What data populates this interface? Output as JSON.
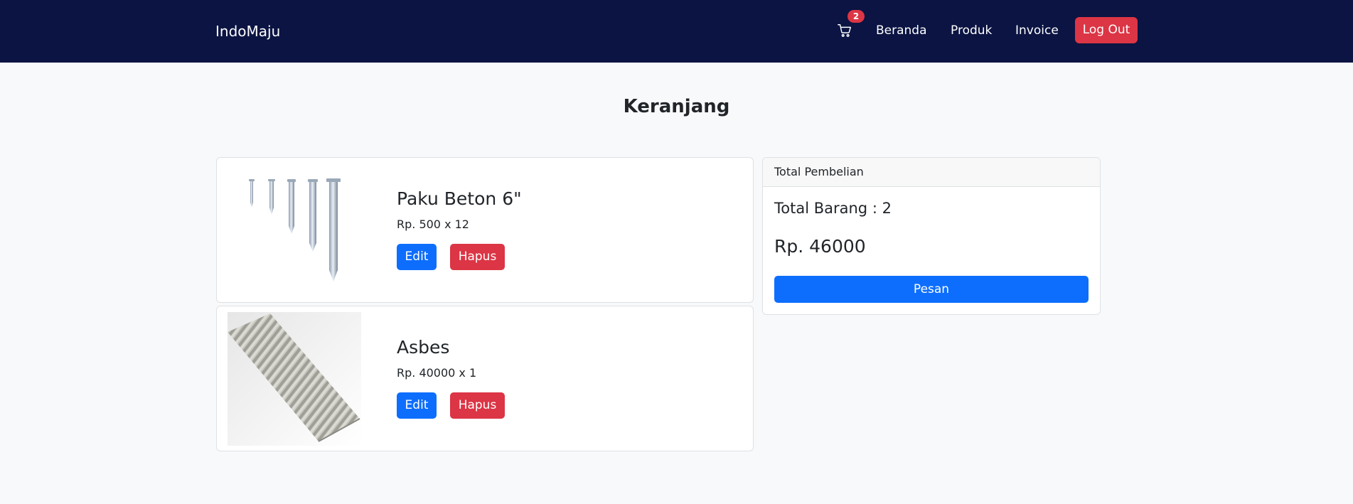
{
  "navbar": {
    "brand": "IndoMaju",
    "cart_icon": "cart-icon",
    "cart_count": "2",
    "links": [
      "Beranda",
      "Produk",
      "Invoice"
    ],
    "logout_label": "Log Out",
    "background_color": "#0b1442"
  },
  "page": {
    "title": "Keranjang"
  },
  "cart_items": [
    {
      "name": "Paku Beton 6\"",
      "price_line": "Rp. 500 x 12",
      "edit_label": "Edit",
      "delete_label": "Hapus"
    },
    {
      "name": "Asbes",
      "price_line": "Rp. 40000 x 1",
      "edit_label": "Edit",
      "delete_label": "Hapus"
    }
  ],
  "summary": {
    "header": "Total Pembelian",
    "total_items": "Total Barang : 2",
    "total_price": "Rp. 46000",
    "order_label": "Pesan"
  },
  "colors": {
    "primary": "#0d6efd",
    "danger": "#dc3545"
  }
}
